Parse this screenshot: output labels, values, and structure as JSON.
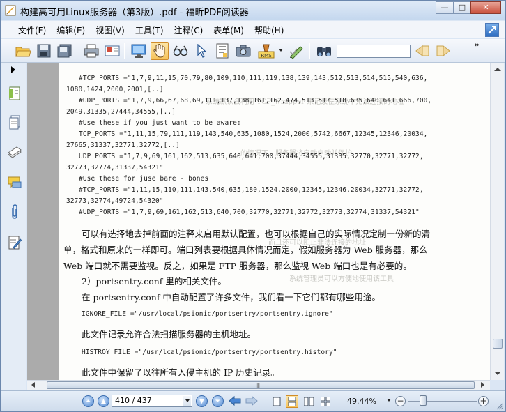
{
  "window": {
    "title": "构建高可用Linux服务器（第3版）.pdf - 福昕PDF阅读器",
    "buttons": {
      "minimize": "—",
      "maximize": "□",
      "close": "✕"
    }
  },
  "menu": {
    "items": [
      "文件(F)",
      "编辑(E)",
      "视图(V)",
      "工具(T)",
      "注释(C)",
      "表单(M)",
      "帮助(H)"
    ]
  },
  "toolbar": {
    "search_value": "",
    "more": "»",
    "stamp_label": "RMS"
  },
  "document": {
    "code_block_1": [
      "#TCP_PORTS =\"1,7,9,11,15,70,79,80,109,110,111,119,138,139,143,512,513,514,515,540,636,",
      "1080,1424,2000,2001,[..]",
      "#UDP_PORTS =\"1,7,9,66,67,68,69,111,137,138,161,162,474,513,517,518,635,640,641,666,700,",
      "2049,31335,27444,34555,[..]",
      "#Use these if you just want to be aware:",
      "TCP_PORTS =\"1,11,15,79,111,119,143,540,635,1080,1524,2000,5742,6667,12345,12346,20034,",
      "27665,31337,32771,32772,[..]",
      "UDP_PORTS =\"1,7,9,69,161,162,513,635,640,641,700,37444,34555,31335,32770,32771,32772,",
      "32773,32774,31337,54321\"",
      "#Use these for juse bare - bones",
      "#TCP_PORTS =\"1,11,15,110,111,143,540,635,180,1524,2000,12345,12346,20034,32771,32772,",
      "32773,32774,49724,54320\"",
      "#UDP_PORTS =\"1,7,9,69,161,162,513,640,700,32770,32771,32772,32773,32774,31337,54321\""
    ],
    "paragraph_1": [
      "可以有选择地去掉前面的注释来启用默认配置，也可以根据自己的实际情况定制一份新的清",
      "单，格式和原来的一样即可。端口列表要根据具体情况而定，假如服务器为 Web 服务器，那么",
      "Web 端口就不需要监视。反之，如果是 FTP 服务器，那么监视 Web 端口也是有必要的。"
    ],
    "heading_2": "2）portsentry.conf 里的相关文件。",
    "paragraph_2": "在 portsentry.conf 中自动配置了许多文件，我们看一下它们都有哪些用途。",
    "ignore_line": "IGNORE_FILE =\"/usr/local/psionic/portsentry/portsentry.ignore\"",
    "ignore_desc": "此文件记录允许合法扫描服务器的主机地址。",
    "history_line": "HISTROY_FILE =\"/usr/lcal/psionic/portsentry/portsentry.history\"",
    "history_desc": "此文件中保留了以往所有入侵主机的 IP 历史记录。"
  },
  "statusbar": {
    "page_display": "410 / 437",
    "zoom": "49.44%",
    "zoom_out": "−",
    "zoom_in": "+"
  },
  "colors": {
    "titlebar": "#c4d7ee",
    "active_tool": "#f6c35b",
    "doc_background": "#ababab",
    "page": "#fdfdfb"
  }
}
